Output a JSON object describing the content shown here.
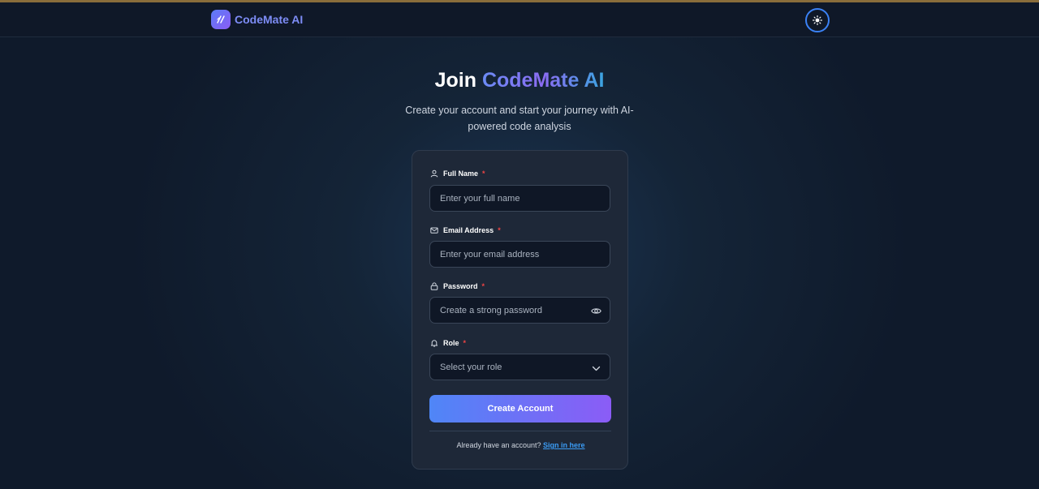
{
  "brand": {
    "name": "CodeMate AI",
    "logo_icon": "codemate-logo-icon"
  },
  "navbar": {
    "theme_toggle_icon": "sun-icon"
  },
  "hero": {
    "title_prefix": "Join",
    "title_accent": "CodeMate AI",
    "subtitle": "Create your account and start your journey with AI-powered code analysis"
  },
  "form": {
    "full_name": {
      "label": "Full Name",
      "required_mark": "*",
      "placeholder": "Enter your full name",
      "icon": "user-icon"
    },
    "email": {
      "label": "Email Address",
      "required_mark": "*",
      "placeholder": "Enter your email address",
      "icon": "mail-icon"
    },
    "password": {
      "label": "Password",
      "required_mark": "*",
      "placeholder": "Create a strong password",
      "icon": "lock-icon",
      "toggle_icon": "eye-icon"
    },
    "role": {
      "label": "Role",
      "required_mark": "*",
      "selected": "Select your role",
      "icon": "bell-icon",
      "chevron_icon": "chevron-down-icon"
    },
    "submit_label": "Create Account",
    "signin_prompt": "Already have an account?",
    "signin_link": "Sign in here"
  },
  "colors": {
    "accent_blue": "#3b82f6",
    "accent_purple": "#8b5cf6",
    "required": "#ef4444",
    "card_bg": "#1e2838",
    "page_bg": "#0f1a2b"
  }
}
